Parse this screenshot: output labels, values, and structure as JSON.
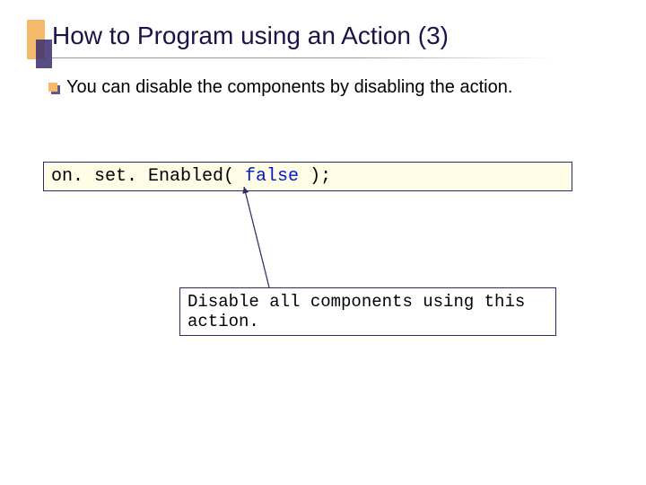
{
  "title": "How to Program using an Action (3)",
  "body": "You can disable the components by disabling the action.",
  "code": {
    "pre": "on. set. Enabled( ",
    "keyword": "false",
    "post": " );"
  },
  "annotation": "Disable all components using this action."
}
